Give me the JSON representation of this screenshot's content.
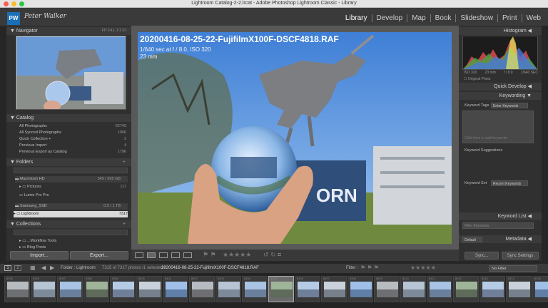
{
  "window": {
    "title": "Lightroom Catalog-2-2.lrcat - Adobe Photoshop Lightroom Classic - Library"
  },
  "identity": {
    "logo_text": "PW",
    "signature": "Peter Walker"
  },
  "modules": [
    "Library",
    "Develop",
    "Map",
    "Book",
    "Slideshow",
    "Print",
    "Web"
  ],
  "navigator": {
    "label": "Navigator",
    "zoom_options": [
      "FIT",
      "FILL",
      "1:1",
      "3:1"
    ]
  },
  "catalog": {
    "label": "Catalog",
    "items": [
      {
        "label": "All Photographs",
        "count": "62749"
      },
      {
        "label": "All Synced Photographs",
        "count": "1006"
      },
      {
        "label": "Quick Collection +",
        "count": "2"
      },
      {
        "label": "Previous Import",
        "count": "4"
      },
      {
        "label": "Previous Export as Catalog",
        "count": "1796"
      }
    ]
  },
  "folders": {
    "label": "Folders",
    "volume1": {
      "label": "Macintosh HD",
      "info": "345 / 995 GB"
    },
    "items": [
      {
        "label": "Pictures",
        "count": "117"
      },
      {
        "label": "Lumix Pro Pro",
        "count": ""
      }
    ],
    "volume2": {
      "label": "Samsung_SSD",
      "info": "0.5 / 1 TB"
    },
    "selected": {
      "label": "Lightroom",
      "count": "7317"
    }
  },
  "collections": {
    "label": "Collections",
    "items": [
      "...Workflow Tools",
      "Blog Posts"
    ]
  },
  "left_buttons": {
    "import": "Import...",
    "export": "Export..."
  },
  "photo": {
    "filename": "20200416-08-25-22-FujifilmX100F-DSCF4818.RAF",
    "exposure": "1/640 sec at f / 8.0, ISO 320",
    "focal": "23 mm"
  },
  "histogram": {
    "label": "Histogram",
    "iso": "ISO 320",
    "focal": "23 mm",
    "aperture": "f / 8.0",
    "shutter": "1/640 SEC",
    "original_photo": "Original Photo"
  },
  "right_panels": {
    "quick_develop": "Quick Develop",
    "keywording": "Keywording",
    "keyword_tags_label": "Keyword Tags",
    "keyword_tags_value": "Enter Keywords",
    "click_here": "Click here to add keywords",
    "keyword_suggestions": "Keyword Suggestions",
    "keyword_set_label": "Keyword Set",
    "keyword_set_value": "Recent Keywords",
    "keyword_list": "Keyword List",
    "filter_keywords": "Filter Keywords",
    "metadata": "Metadata",
    "metadata_preset": "Default"
  },
  "sync": {
    "sync": "Sync...",
    "sync_settings": "Sync Settings"
  },
  "filmstrip": {
    "pages": [
      "1",
      "2"
    ],
    "source": "Folder : Lightroom",
    "status": "7315 of 7317 photos /1 selected /",
    "selected_file": "20200416-08-25-22-FujifilmX100F-DSCF4818.RAF",
    "filter_label": "Filter :",
    "filter_value": "No Filter",
    "thumb_numbers": [
      "8395",
      "8396",
      "8397",
      "8398",
      "8399",
      "8400",
      "8401",
      "8402",
      "8403",
      "8404",
      "8405",
      "8406",
      "8407",
      "8408",
      "8409",
      "8410",
      "8411",
      "8412",
      "8413",
      "8414",
      "8415"
    ]
  },
  "colors": {
    "accent": "#1b6fb6",
    "panel_bg": "#303030",
    "header_bg": "#3a3a3a",
    "center_bg": "#595959"
  }
}
